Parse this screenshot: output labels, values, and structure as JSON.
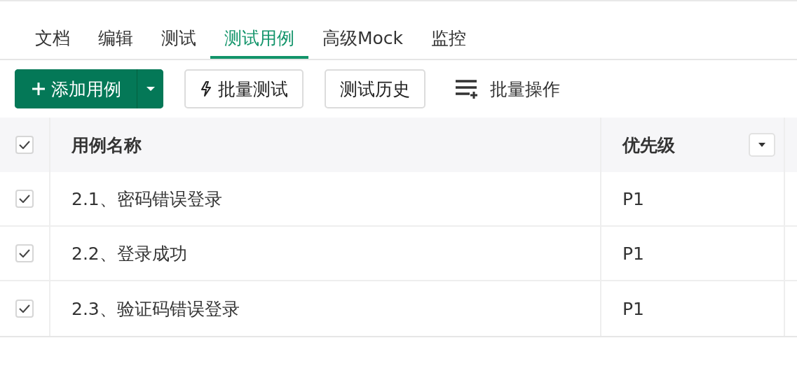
{
  "tabs": [
    {
      "label": "文档",
      "selected": false
    },
    {
      "label": "编辑",
      "selected": false
    },
    {
      "label": "测试",
      "selected": false
    },
    {
      "label": "测试用例",
      "selected": true
    },
    {
      "label": "高级Mock",
      "selected": false
    },
    {
      "label": "监控",
      "selected": false
    }
  ],
  "toolbar": {
    "add_button": "添加用例",
    "batch_test": "批量测试",
    "history": "测试历史",
    "batch_ops": "批量操作"
  },
  "table": {
    "all_checked": true,
    "columns": [
      "用例名称",
      "优先级"
    ],
    "rows": [
      {
        "checked": true,
        "name": "2.1、密码错误登录",
        "priority": "P1"
      },
      {
        "checked": true,
        "name": "2.2、登录成功",
        "priority": "P1"
      },
      {
        "checked": true,
        "name": "2.3、验证码错误登录",
        "priority": "P1"
      }
    ]
  }
}
